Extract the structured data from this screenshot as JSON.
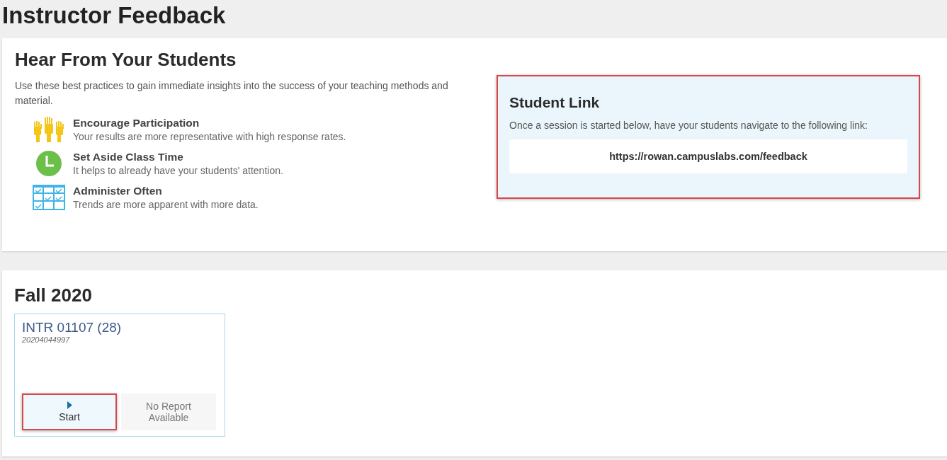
{
  "page_title": "Instructor Feedback",
  "intro": {
    "title": "Hear From Your Students",
    "description": "Use these best practices to gain immediate insights into the success of your teaching methods and material.",
    "practices": [
      {
        "kind": "hands",
        "title": "Encourage Participation",
        "text": "Your results are more representative with high response rates."
      },
      {
        "kind": "clock",
        "title": "Set Aside Class Time",
        "text": "It helps to already have your students' attention."
      },
      {
        "kind": "calendar",
        "title": "Administer Often",
        "text": "Trends are more apparent with more data."
      }
    ]
  },
  "student_link": {
    "highlighted": true,
    "title": "Student Link",
    "text": "Once a session is started below, have your students navigate to the following link:",
    "url": "https://rowan.campuslabs.com/feedback"
  },
  "term": {
    "title": "Fall 2020",
    "courses": [
      {
        "name": "INTR 01107 (28)",
        "id": "20204044997",
        "start": {
          "label": "Start",
          "highlighted": true
        },
        "report": {
          "label": "No Report Available",
          "disabled": true
        }
      }
    ]
  }
}
